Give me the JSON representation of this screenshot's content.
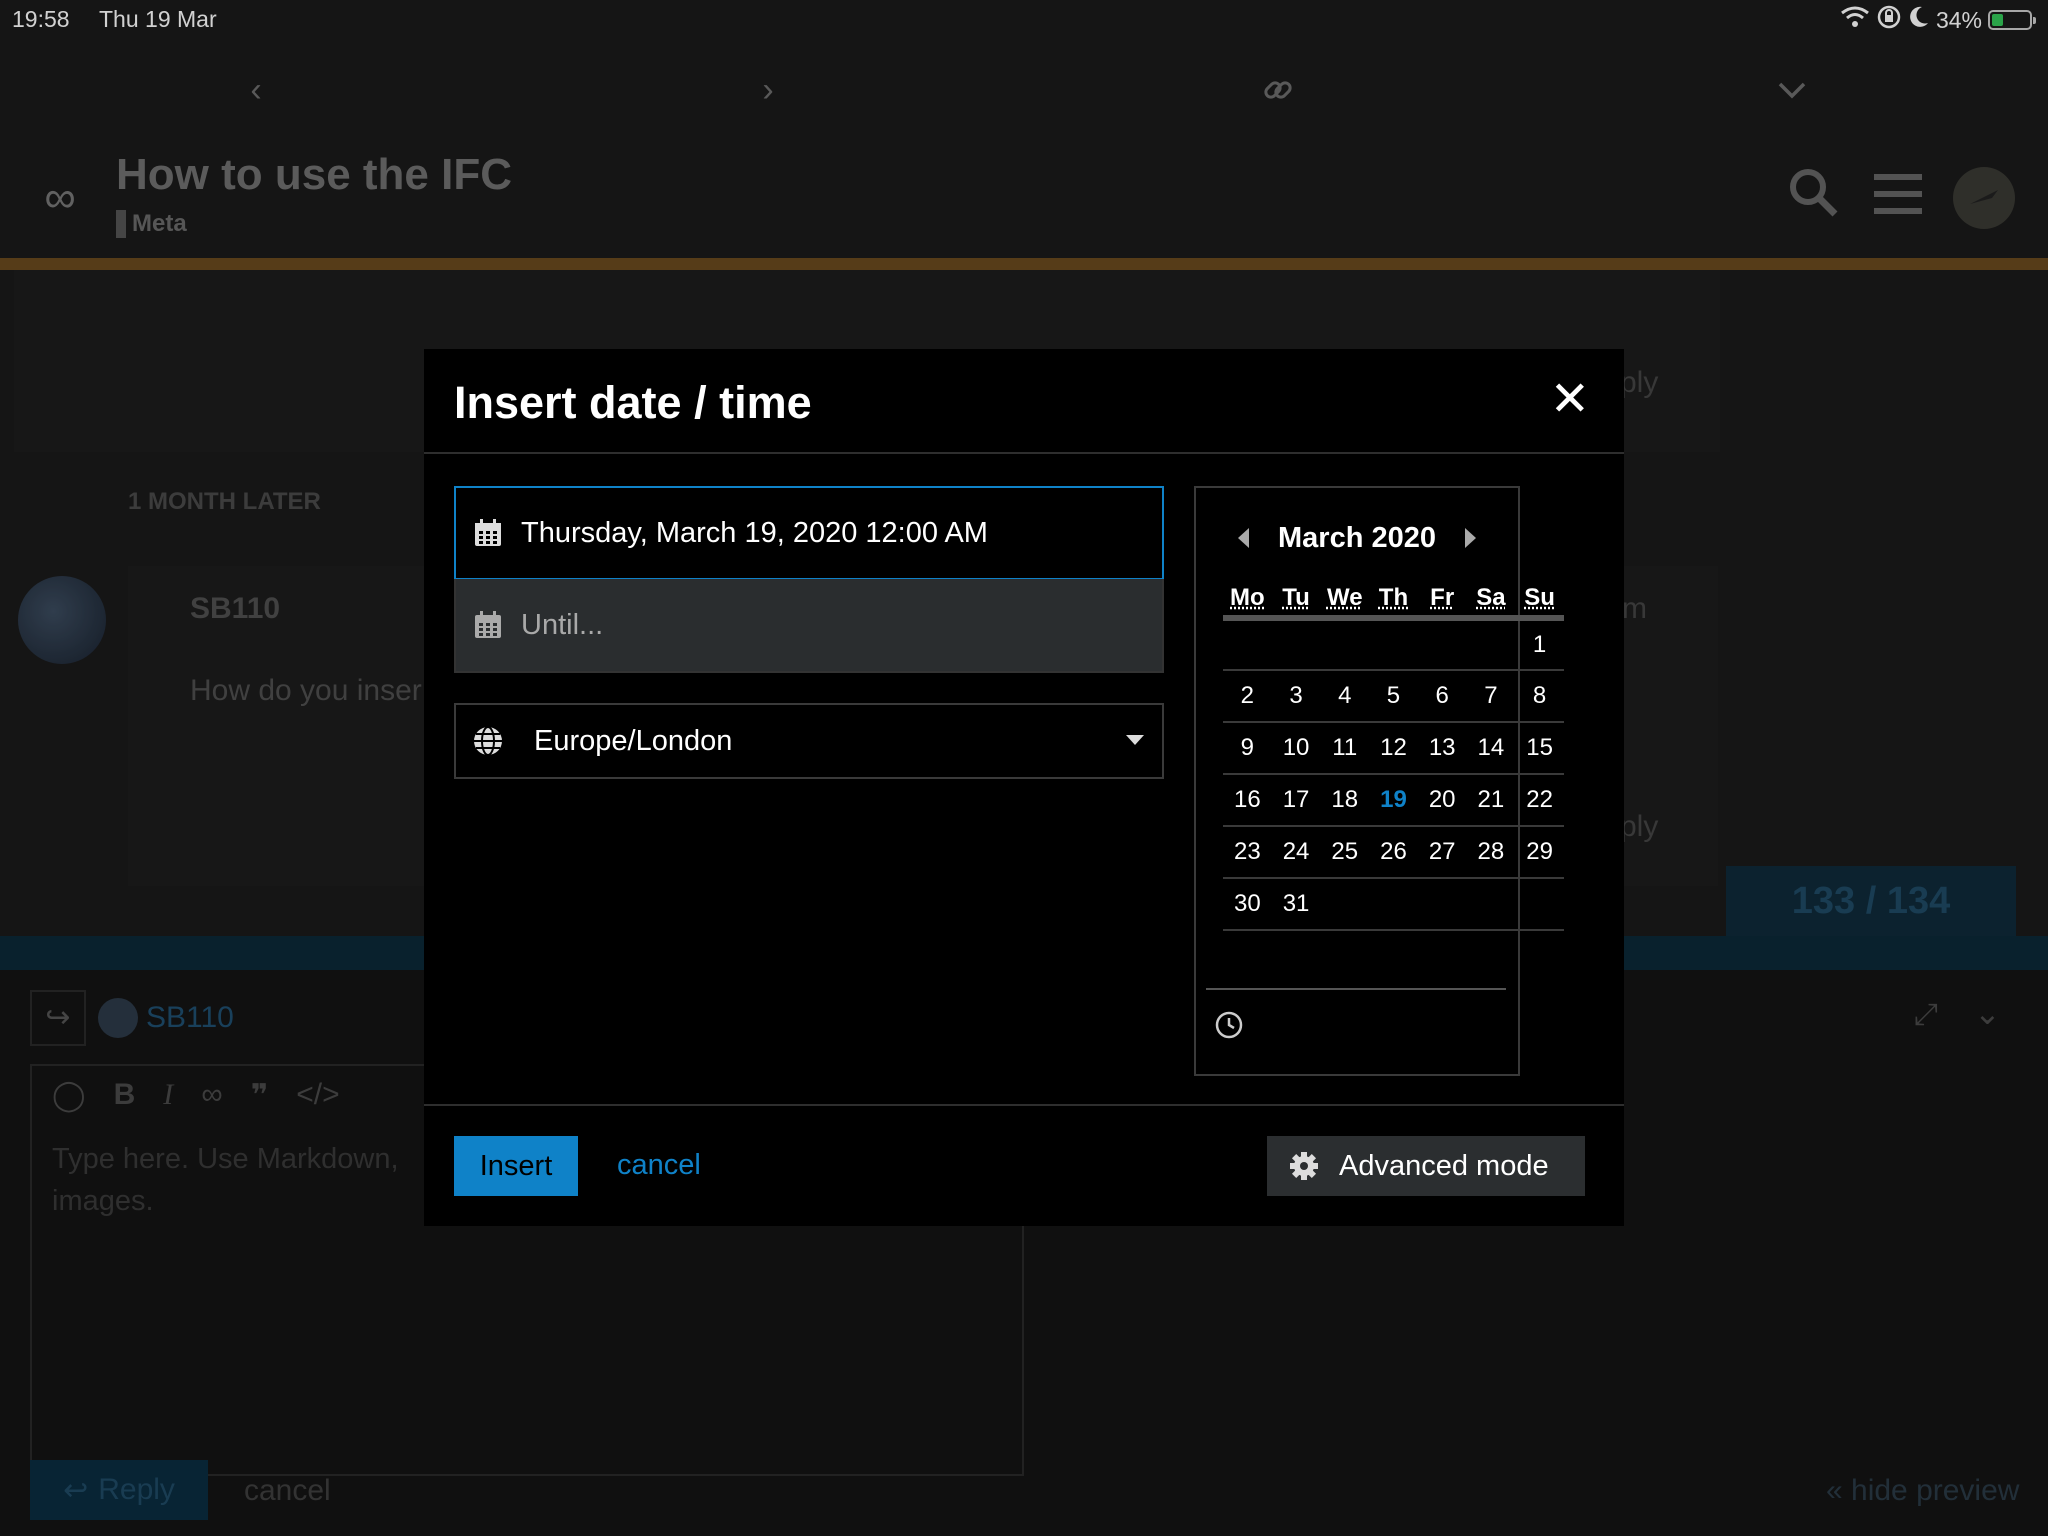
{
  "status_bar": {
    "time": "19:58",
    "date": "Thu 19 Mar",
    "battery": "34%"
  },
  "page": {
    "topic_title": "How to use the IFC",
    "category": "Meta",
    "timeline_label": "1 MONTH LATER",
    "post_author": "SB110",
    "post_excerpt": "How do you inser",
    "reply_fragment_1": "ply",
    "reply_fragment_2": "ply",
    "edge_fragment": "m",
    "progress": "133 / 134"
  },
  "composer": {
    "username": "SB110",
    "placeholder": "Type here. Use Markdown, images.",
    "reply_label": "Reply",
    "cancel_label": "cancel",
    "hide_preview_label": "« hide preview"
  },
  "modal": {
    "title": "Insert date / time",
    "from_value": "Thursday, March 19, 2020 12:00 AM",
    "until_placeholder": "Until...",
    "timezone": "Europe/London",
    "insert_label": "Insert",
    "cancel_label": "cancel",
    "advanced_label": "Advanced mode"
  },
  "calendar": {
    "month_label": "March 2020",
    "weekdays": [
      "Mo",
      "Tu",
      "We",
      "Th",
      "Fr",
      "Sa",
      "Su"
    ],
    "weeks": [
      [
        "",
        "",
        "",
        "",
        "",
        "",
        "1"
      ],
      [
        "2",
        "3",
        "4",
        "5",
        "6",
        "7",
        "8"
      ],
      [
        "9",
        "10",
        "11",
        "12",
        "13",
        "14",
        "15"
      ],
      [
        "16",
        "17",
        "18",
        "19",
        "20",
        "21",
        "22"
      ],
      [
        "23",
        "24",
        "25",
        "26",
        "27",
        "28",
        "29"
      ],
      [
        "30",
        "31",
        "",
        "",
        "",
        "",
        ""
      ]
    ],
    "selected_day": "19"
  },
  "colors": {
    "accent": "#0f82c8",
    "battery": "#34c759"
  }
}
